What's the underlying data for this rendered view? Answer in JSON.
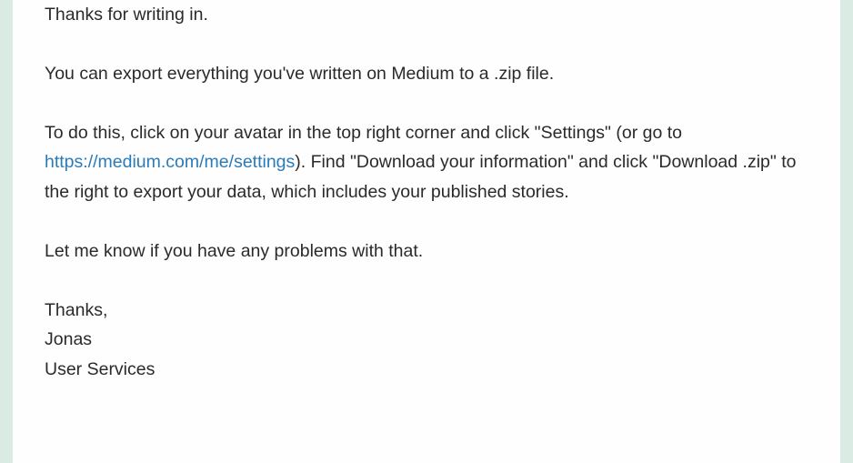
{
  "email": {
    "greeting": "Thanks for writing in.",
    "p2": "You can export everything you've written on Medium to a .zip file.",
    "p3_pre": "To do this, click on your avatar in the top right corner and click \"Settings\" (or go to ",
    "p3_link": "https://medium.com/me/settings",
    "p3_post": "). Find \"Download your information\" and click \"Download .zip\" to the right to export your data, which includes your published stories.",
    "p4": "Let me know if you have any problems with that.",
    "closing": "Thanks,",
    "name": "Jonas",
    "team": "User Services"
  }
}
